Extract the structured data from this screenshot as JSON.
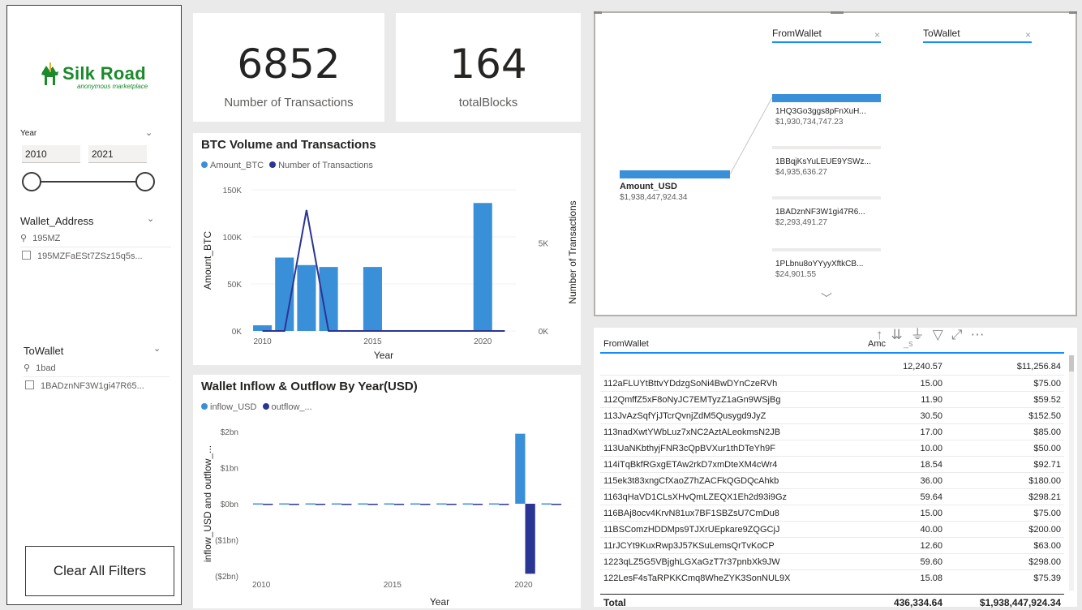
{
  "sidebar": {
    "logo": {
      "title": "Silk Road",
      "subtitle": "anonymous marketplace"
    },
    "year_slicer": {
      "title": "Year",
      "from": "2010",
      "to": "2021"
    },
    "wallet_slicer": {
      "title": "Wallet_Address",
      "search": "195MZ",
      "item": "195MZFaESt7ZSz15q5s..."
    },
    "towallet_slicer": {
      "title": "ToWallet",
      "search": "1bad",
      "item": "1BADznNF3W1gi47R65..."
    },
    "clear_button": "Clear All Filters"
  },
  "cards": [
    {
      "value": "6852",
      "label": "Number of Transactions"
    },
    {
      "value": "164",
      "label": "totalBlocks"
    }
  ],
  "chart_data": [
    {
      "type": "bar",
      "title": "BTC Volume and Transactions",
      "legend": [
        "Amount_BTC",
        "Number of Transactions"
      ],
      "xlabel": "Year",
      "ylabel": "Amount_BTC",
      "y2label": "Number of Transactions",
      "x_ticks": [
        "2010",
        "2015",
        "2020"
      ],
      "y_ticks": [
        "0K",
        "50K",
        "100K",
        "150K"
      ],
      "y2_ticks": [
        "0K",
        "5K"
      ],
      "ylim": [
        0,
        150000
      ],
      "y2lim": [
        0,
        8000
      ],
      "xlim": [
        2009.5,
        2021.5
      ],
      "categories": [
        2010,
        2011,
        2012,
        2013,
        2014,
        2015,
        2016,
        2017,
        2018,
        2019,
        2020,
        2021
      ],
      "series": [
        {
          "name": "Amount_BTC",
          "type": "bar",
          "values": [
            6000,
            78000,
            70000,
            68000,
            0,
            68000,
            0,
            0,
            0,
            0,
            136000,
            0
          ]
        },
        {
          "name": "Number of Transactions",
          "type": "line",
          "values": [
            0,
            0,
            6852,
            0,
            0,
            0,
            0,
            0,
            0,
            0,
            0,
            0
          ]
        }
      ],
      "colors": {
        "Amount_BTC": "#3a8fd9",
        "Number of Transactions": "#2b3594"
      }
    },
    {
      "type": "bar",
      "title": "Wallet Inflow & Outflow By Year(USD)",
      "legend": [
        "inflow_USD",
        "outflow_..."
      ],
      "xlabel": "Year",
      "ylabel": "inflow_USD and outflow_...",
      "x_ticks": [
        "2010",
        "2015",
        "2020"
      ],
      "y_ticks": [
        "($2bn)",
        "($1bn)",
        "$0bn",
        "$1bn",
        "$2bn"
      ],
      "ylim": [
        -2,
        2
      ],
      "xlim": [
        2009.5,
        2021.5
      ],
      "categories": [
        2010,
        2011,
        2012,
        2013,
        2014,
        2015,
        2016,
        2017,
        2018,
        2019,
        2020,
        2021
      ],
      "series": [
        {
          "name": "inflow_USD",
          "values": [
            0.01,
            0.01,
            0.01,
            0.01,
            0.01,
            0.01,
            0.01,
            0.01,
            0.01,
            0.01,
            1.94,
            0.01
          ]
        },
        {
          "name": "outflow_...",
          "values": [
            -0.01,
            -0.01,
            -0.01,
            -0.01,
            -0.01,
            -0.01,
            -0.01,
            -0.01,
            -0.01,
            -0.01,
            -1.94,
            -0.01
          ]
        }
      ],
      "colors": {
        "inflow_USD": "#3a8fd9",
        "outflow_...": "#2b3594"
      }
    }
  ],
  "decomp_tree": {
    "headers": [
      "FromWallet",
      "ToWallet"
    ],
    "root": {
      "label": "Amount_USD",
      "value": "$1,938,447,924.34"
    },
    "nodes": [
      {
        "label": "1HQ3Go3ggs8pFnXuH...",
        "value": "$1,930,734,747.23"
      },
      {
        "label": "1BBqjKsYuLEUE9YSWz...",
        "value": "$4,935,636.27"
      },
      {
        "label": "1BADznNF3W1gi47R6...",
        "value": "$2,293,491.27"
      },
      {
        "label": "1PLbnu8oYYyyXftkCB...",
        "value": "$24,901.55"
      }
    ]
  },
  "table": {
    "headers": [
      "FromWallet",
      "Amc",
      "_s"
    ],
    "first_row": {
      "amount": "12,240.57",
      "usd": "$11,256.84"
    },
    "rows": [
      {
        "wallet": "112aFLUYtBttvYDdzgSoNi4BwDYnCzeRVh",
        "amount": "15.00",
        "usd": "$75.00"
      },
      {
        "wallet": "112QmffZ5xF8oNyJC7EMTyzZ1aGn9WSjBg",
        "amount": "11.90",
        "usd": "$59.52"
      },
      {
        "wallet": "113JvAzSqfYjJTcrQvnjZdM5Qusygd9JyZ",
        "amount": "30.50",
        "usd": "$152.50"
      },
      {
        "wallet": "113nadXwtYWbLuz7xNC2AztALeokmsN2JB",
        "amount": "17.00",
        "usd": "$85.00"
      },
      {
        "wallet": "113UaNKbthyjFNR3cQpBVXur1thDTeYh9F",
        "amount": "10.00",
        "usd": "$50.00"
      },
      {
        "wallet": "114iTqBkfRGxgETAw2rkD7xmDteXM4cWr4",
        "amount": "18.54",
        "usd": "$92.71"
      },
      {
        "wallet": "115ek3t83xngCfXaoZ7hZACFkQGDQcAhkb",
        "amount": "36.00",
        "usd": "$180.00"
      },
      {
        "wallet": "1163qHaVD1CLsXHvQmLZEQX1Eh2d93i9Gz",
        "amount": "59.64",
        "usd": "$298.21"
      },
      {
        "wallet": "116BAj8ocv4KrvN81ux7BF1SBZsU7CmDu8",
        "amount": "15.00",
        "usd": "$75.00"
      },
      {
        "wallet": "11BSComzHDDMps9TJXrUEpkare9ZQGCjJ",
        "amount": "40.00",
        "usd": "$200.00"
      },
      {
        "wallet": "11rJCYt9KuxRwp3J57KSuLemsQrTvKoCP",
        "amount": "12.60",
        "usd": "$63.00"
      },
      {
        "wallet": "1223qLZ5G5VBjghLGXaGzT7r37pnbXk9JW",
        "amount": "59.60",
        "usd": "$298.00"
      },
      {
        "wallet": "122LesF4sTaRPKKCmq8WheZYK3SonNUL9X",
        "amount": "15.08",
        "usd": "$75.39"
      }
    ],
    "total": {
      "label": "Total",
      "amount": "436,334.64",
      "usd": "$1,938,447,924.34"
    }
  },
  "icons": [
    "search-icon",
    "chevron-down-icon",
    "close-icon",
    "sort-icon",
    "filter-icon",
    "focus-mode-icon",
    "more-options-icon"
  ]
}
